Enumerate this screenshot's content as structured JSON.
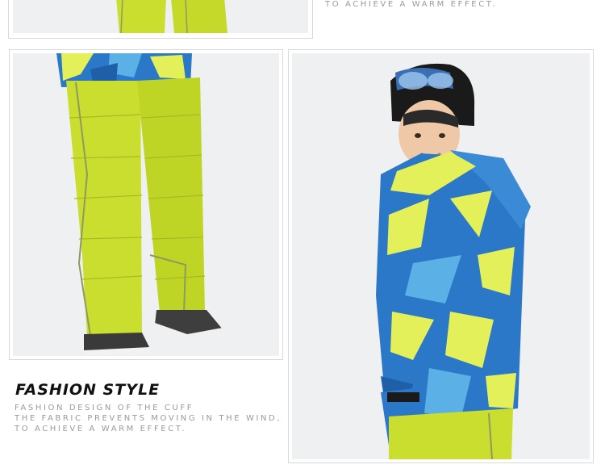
{
  "top_caption": "TO ACHIEVE A WARM EFFECT.",
  "section": {
    "title": "FASHION STYLE",
    "lines": [
      "FASHION DESIGN OF THE CUFF",
      "THE FABRIC PREVENTS MOVING IN THE WIND,",
      "TO ACHIEVE A WARM EFFECT."
    ]
  },
  "colors": {
    "pants_green": "#c9de2e",
    "jacket_blue": "#2b78c8",
    "jacket_yellow": "#e4f05a",
    "caption_gray": "#9a9a9a",
    "frame_border": "#d9d9d9"
  }
}
